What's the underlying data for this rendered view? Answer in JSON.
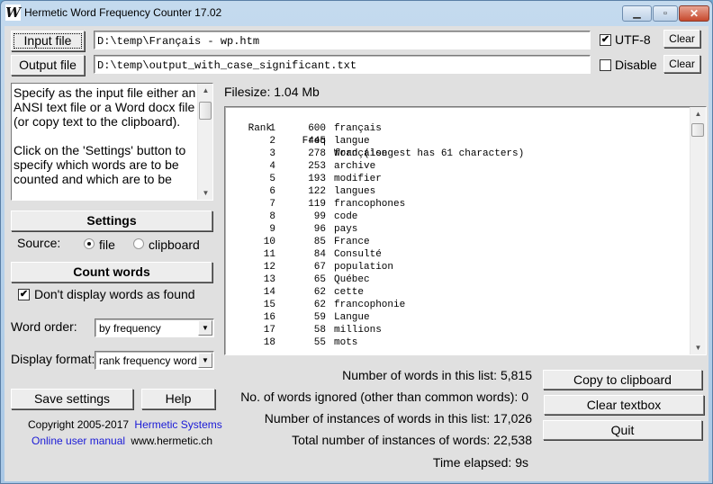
{
  "window": {
    "title": "Hermetic Word Frequency Counter 17.02",
    "app_icon_glyph": "W",
    "controls": {
      "minimize": "▁",
      "maximize": "▫",
      "close": "✕"
    }
  },
  "files": {
    "input_button": "Input file",
    "input_path": "D:\\temp\\Français - wp.htm",
    "output_button": "Output file",
    "output_path": "D:\\temp\\output_with_case_significant.txt",
    "utf8_label": "UTF-8",
    "utf8_checked": true,
    "disable_label": "Disable",
    "disable_checked": false,
    "clear_label": "Clear"
  },
  "help_text": "Specify as the input file either an\nANSI text file or a Word docx file\n(or copy text to the clipboard).\n\nClick on the 'Settings' button to\nspecify which words are to be\ncounted and which are to be",
  "left_panel": {
    "settings_button": "Settings",
    "source_label": "Source:",
    "source_options": [
      "file",
      "clipboard"
    ],
    "source_selected": "file",
    "count_words_button": "Count words",
    "dont_display_label": "Don't display words as found",
    "dont_display_checked": true,
    "word_order_label": "Word order:",
    "word_order_value": "by frequency",
    "display_format_label": "Display format:",
    "display_format_value": "rank frequency word",
    "save_settings_button": "Save settings",
    "help_button": "Help",
    "copyright": "Copyright 2005-2017",
    "company_link": "Hermetic Systems",
    "manual_link": "Online user manual",
    "website": "www.hermetic.ch"
  },
  "filesize_label": "Filesize: 1.04 Mb",
  "results": {
    "header": {
      "rank": "Rank",
      "freq": "Freq",
      "word": "Word (longest has 61 characters)"
    },
    "rows": [
      {
        "rank": "1",
        "freq": "600",
        "word": "français"
      },
      {
        "rank": "2",
        "freq": "445",
        "word": "langue"
      },
      {
        "rank": "3",
        "freq": "278",
        "word": "française"
      },
      {
        "rank": "4",
        "freq": "253",
        "word": "archive"
      },
      {
        "rank": "5",
        "freq": "193",
        "word": "modifier"
      },
      {
        "rank": "6",
        "freq": "122",
        "word": "langues"
      },
      {
        "rank": "7",
        "freq": "119",
        "word": "francophones"
      },
      {
        "rank": "8",
        "freq": "99",
        "word": "code"
      },
      {
        "rank": "9",
        "freq": "96",
        "word": "pays"
      },
      {
        "rank": "10",
        "freq": "85",
        "word": "France"
      },
      {
        "rank": "11",
        "freq": "84",
        "word": "Consulté"
      },
      {
        "rank": "12",
        "freq": "67",
        "word": "population"
      },
      {
        "rank": "13",
        "freq": "65",
        "word": "Québec"
      },
      {
        "rank": "14",
        "freq": "62",
        "word": "cette"
      },
      {
        "rank": "15",
        "freq": "62",
        "word": "francophonie"
      },
      {
        "rank": "16",
        "freq": "59",
        "word": "Langue"
      },
      {
        "rank": "17",
        "freq": "58",
        "word": "millions"
      },
      {
        "rank": "18",
        "freq": "55",
        "word": "mots"
      }
    ]
  },
  "stats": {
    "words_in_list": "Number of words in this list:  5,815",
    "words_ignored": "No. of words ignored (other than common words):     0",
    "instances_in_list": "Number of instances of words in this list: 17,026",
    "total_instances": "Total number of instances of words: 22,538",
    "time_elapsed": "Time elapsed: 9s"
  },
  "actions": {
    "copy_button": "Copy to clipboard",
    "clear_textbox_button": "Clear textbox",
    "quit_button": "Quit"
  }
}
